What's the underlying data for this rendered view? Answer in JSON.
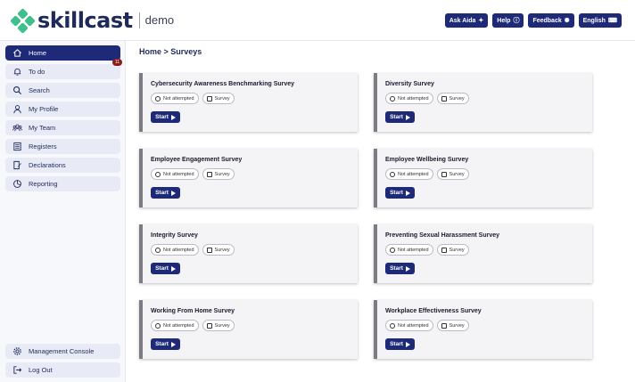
{
  "header": {
    "brand": "skillcast",
    "sub_brand": "demo",
    "buttons": [
      {
        "label": "Ask Aida",
        "icon": "sparkle-icon"
      },
      {
        "label": "Help",
        "icon": "help-circle-icon"
      },
      {
        "label": "Feedback",
        "icon": "lightbulb-icon"
      },
      {
        "label": "English",
        "icon": "keyboard-icon"
      }
    ]
  },
  "sidebar": {
    "items": [
      {
        "label": "Home",
        "icon": "home-icon",
        "active": true
      },
      {
        "label": "To do",
        "icon": "bell-icon",
        "badge": "11"
      },
      {
        "label": "Search",
        "icon": "search-icon"
      },
      {
        "label": "My Profile",
        "icon": "user-icon"
      },
      {
        "label": "My Team",
        "icon": "team-icon"
      },
      {
        "label": "Registers",
        "icon": "register-icon"
      },
      {
        "label": "Declarations",
        "icon": "declaration-icon"
      },
      {
        "label": "Reporting",
        "icon": "pie-chart-icon"
      }
    ],
    "bottom": [
      {
        "label": "Management Console",
        "icon": "gear-icon"
      },
      {
        "label": "Log Out",
        "icon": "logout-icon"
      }
    ]
  },
  "breadcrumb": "Home > Surveys",
  "cards": [
    {
      "title": "Cybersecurity Awareness Benchmarking Survey",
      "status": "Not attempted",
      "type": "Survey",
      "action": "Start"
    },
    {
      "title": "Diversity Survey",
      "status": "Not attempted",
      "type": "Survey",
      "action": "Start"
    },
    {
      "title": "Employee Engagement Survey",
      "status": "Not attempted",
      "type": "Survey",
      "action": "Start"
    },
    {
      "title": "Employee Wellbeing Survey",
      "status": "Not attempted",
      "type": "Survey",
      "action": "Start"
    },
    {
      "title": "Integrity Survey",
      "status": "Not attempted",
      "type": "Survey",
      "action": "Start"
    },
    {
      "title": "Preventing Sexual Harassment Survey",
      "status": "Not attempted",
      "type": "Survey",
      "action": "Start"
    },
    {
      "title": "Working From Home Survey",
      "status": "Not attempted",
      "type": "Survey",
      "action": "Start"
    },
    {
      "title": "Workplace Effectiveness Survey",
      "status": "Not attempted",
      "type": "Survey",
      "action": "Start"
    }
  ],
  "colors": {
    "primary": "#1e2a78",
    "brand_green": "#3fbf8c",
    "badge": "#8b1a1a"
  }
}
